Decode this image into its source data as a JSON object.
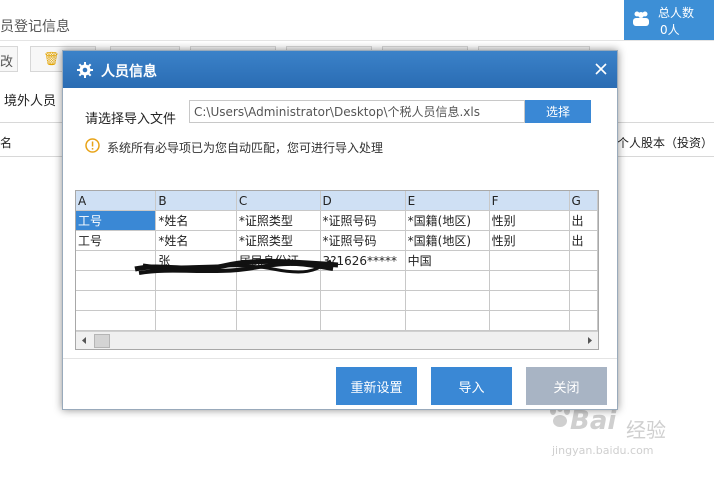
{
  "app": {
    "title": "员登记信息",
    "total": {
      "label": "总人数",
      "count": "0人"
    },
    "toolbar_partial_label": "改",
    "outside_label": "境外人员",
    "columns": {
      "name": "名",
      "equity": "个人股本（投资）"
    }
  },
  "dialog": {
    "title": "人员信息",
    "file_label": "请选择导入文件",
    "file_path": "C:\\Users\\Administrator\\Desktop\\个税人员信息.xls",
    "select_label": "选择",
    "notice": "系统所有必导项已为您自动匹配，您可进行导入处理",
    "grid": {
      "headers": [
        "A",
        "B",
        "C",
        "D",
        "E",
        "F",
        "G"
      ],
      "rows": [
        [
          "工号",
          "*姓名",
          "*证照类型",
          "*证照号码",
          "*国籍(地区)",
          "性别",
          "出"
        ],
        [
          "工号",
          "*姓名",
          "*证照类型",
          "*证照号码",
          "*国籍(地区)",
          "性别",
          "出"
        ],
        [
          "",
          "张",
          "居民身份证",
          "3?1626*****",
          "中国",
          "",
          ""
        ],
        [
          "",
          "",
          "",
          "",
          "",
          "",
          ""
        ],
        [
          "",
          "",
          "",
          "",
          "",
          "",
          ""
        ],
        [
          "",
          "",
          "",
          "",
          "",
          "",
          ""
        ]
      ]
    },
    "buttons": {
      "reset": "重新设置",
      "import": "导入",
      "close": "关闭"
    }
  },
  "watermark": {
    "brand": "Bai",
    "cn": "经验",
    "url": "jingyan.baidu.com"
  },
  "colors": {
    "accent": "#3a88d5",
    "header": "#2f74bd",
    "close_btn": "#a8b4c4",
    "selected_cell": "#3a88d5"
  }
}
